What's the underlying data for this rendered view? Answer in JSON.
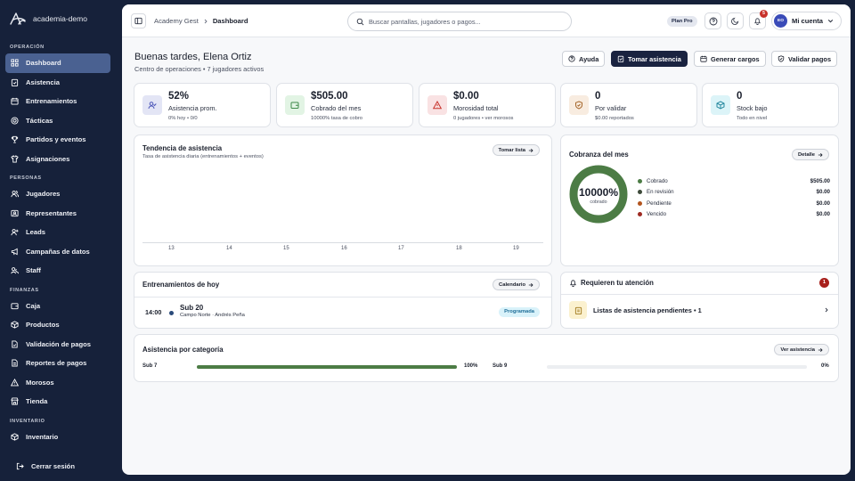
{
  "brand": {
    "name": "academia-demo"
  },
  "sidebar": {
    "sections": [
      {
        "label": "OPERACIÓN",
        "items": [
          {
            "label": "Dashboard",
            "icon": "dashboard-icon",
            "active": true
          },
          {
            "label": "Asistencia",
            "icon": "clipboard-icon"
          },
          {
            "label": "Entrenamientos",
            "icon": "calendar-icon"
          },
          {
            "label": "Tácticas",
            "icon": "target-icon"
          },
          {
            "label": "Partidos y eventos",
            "icon": "trophy-icon"
          },
          {
            "label": "Asignaciones",
            "icon": "shirt-icon"
          }
        ]
      },
      {
        "label": "PERSONAS",
        "items": [
          {
            "label": "Jugadores",
            "icon": "users-icon"
          },
          {
            "label": "Representantes",
            "icon": "id-card-icon"
          },
          {
            "label": "Leads",
            "icon": "user-plus-icon"
          },
          {
            "label": "Campañas de datos",
            "icon": "megaphone-icon"
          },
          {
            "label": "Staff",
            "icon": "staff-icon"
          }
        ]
      },
      {
        "label": "FINANZAS",
        "items": [
          {
            "label": "Caja",
            "icon": "wallet-icon"
          },
          {
            "label": "Productos",
            "icon": "box-icon"
          },
          {
            "label": "Validación de pagos",
            "icon": "file-check-icon"
          },
          {
            "label": "Reportes de pagos",
            "icon": "file-text-icon"
          },
          {
            "label": "Morosos",
            "icon": "alert-triangle-icon"
          },
          {
            "label": "Tienda",
            "icon": "store-icon"
          }
        ]
      },
      {
        "label": "INVENTARIO",
        "items": [
          {
            "label": "Inventario",
            "icon": "package-icon"
          }
        ]
      }
    ],
    "logout": "Cerrar sesión"
  },
  "topbar": {
    "crumb_root": "Academy Gest",
    "crumb_current": "Dashboard",
    "search_placeholder": "Buscar pantallas, jugadores o pagos...",
    "plan": "Plan Pro",
    "notifications": "5",
    "avatar_initials": "EO",
    "account": "Mi cuenta"
  },
  "header": {
    "greeting": "Buenas tardes, Elena Ortiz",
    "subtitle": "Centro de operaciones • 7 jugadores activos",
    "buttons": {
      "help": "Ayuda",
      "attendance": "Tomar asistencia",
      "charges": "Generar cargos",
      "validate": "Validar pagos"
    }
  },
  "stats": [
    {
      "value": "52%",
      "label": "Asistencia prom.",
      "sub": "0% hoy • 0/0",
      "icon": "user-check-icon",
      "color": "#e3e5f5",
      "stroke": "#4b55b8"
    },
    {
      "value": "$505.00",
      "label": "Cobrado del mes",
      "sub": "10000% tasa de cobro",
      "icon": "wallet-icon",
      "color": "#e2f4e4",
      "stroke": "#3f8a4a"
    },
    {
      "value": "$0.00",
      "label": "Morosidad total",
      "sub": "0 jugadores • ver morosos",
      "icon": "alert-triangle-icon",
      "color": "#f9e2e3",
      "stroke": "#c8322b"
    },
    {
      "value": "0",
      "label": "Por validar",
      "sub": "$0.00 reportados",
      "icon": "shield-check-icon",
      "color": "#f8ece0",
      "stroke": "#a5652a"
    },
    {
      "value": "0",
      "label": "Stock bajo",
      "sub": "Todo en nivel",
      "icon": "box-icon",
      "color": "#dcf4f8",
      "stroke": "#25889f"
    }
  ],
  "trend": {
    "title": "Tendencia de asistencia",
    "subtitle": "Tasa de asistencia diaria (entrenamientos + eventos)",
    "button": "Tomar lista",
    "ticks": [
      "13",
      "14",
      "15",
      "16",
      "17",
      "18",
      "19"
    ]
  },
  "collection": {
    "title": "Cobranza del mes",
    "button": "Detalle",
    "donut_value": "10000%",
    "donut_label": "cobrado",
    "ring_color": "#4c7c45",
    "legend": [
      {
        "label": "Cobrado",
        "amount": "$505.00",
        "color": "#4c7c45"
      },
      {
        "label": "En revisión",
        "amount": "$0.00",
        "color": "#3d4a3a"
      },
      {
        "label": "Pendiente",
        "amount": "$0.00",
        "color": "#b3541e"
      },
      {
        "label": "Vencido",
        "amount": "$0.00",
        "color": "#9e2a22"
      }
    ]
  },
  "trainings": {
    "title": "Entrenamientos de hoy",
    "button": "Calendario",
    "items": [
      {
        "time": "14:00",
        "name": "Sub 20",
        "place": "Campo Norte · Andrés Peña",
        "status": "Programada"
      }
    ]
  },
  "attention": {
    "title": "Requieren tu atención",
    "count": "1",
    "items": [
      {
        "label": "Listas de asistencia pendientes • 1"
      }
    ]
  },
  "categories": {
    "title": "Asistencia por categoría",
    "button": "Ver asistencia",
    "items": [
      {
        "name": "Sub 7",
        "percent": "100%",
        "fraction": 1.0
      },
      {
        "name": "Sub 9",
        "percent": "0%",
        "fraction": 0.0
      }
    ]
  }
}
